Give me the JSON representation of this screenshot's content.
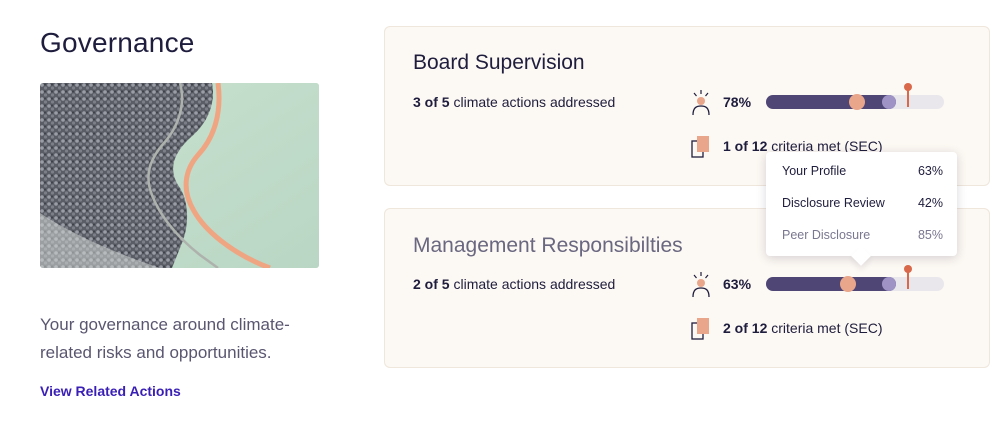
{
  "page": {
    "title": "Governance",
    "description": "Your governance around climate-related risks and opportunities.",
    "related_link": "View Related Actions"
  },
  "colors": {
    "accent": "#3a1fb6",
    "bar_fill": "#4f4676",
    "peer": "#9f93c6",
    "profile": "#e9a68a",
    "marker": "#d9694a",
    "card_bg": "#fcf8f3"
  },
  "cards": [
    {
      "title": "Board Supervision",
      "actions_count": "3 of 5",
      "actions_suffix": "climate actions addressed",
      "percent": "78%",
      "progress": {
        "fill": 0.73,
        "profile": 0.51,
        "peer": 0.69,
        "disclosure": 0.8
      },
      "criteria_count": "1 of 12",
      "criteria_suffix": "criteria met (SEC)",
      "icons": [
        "person-icon",
        "document-icon"
      ]
    },
    {
      "title": "Management Responsibilties",
      "actions_count": "2 of 5",
      "actions_suffix": "climate actions addressed",
      "percent": "63%",
      "progress": {
        "fill": 0.73,
        "profile": 0.46,
        "peer": 0.69,
        "disclosure": 0.8
      },
      "criteria_count": "2 of 12",
      "criteria_suffix": "criteria met (SEC)",
      "icons": [
        "person-icon",
        "document-icon"
      ]
    }
  ],
  "tooltip": {
    "rows": [
      {
        "label": "Your Profile",
        "value": "63%"
      },
      {
        "label": "Disclosure Review",
        "value": "42%"
      },
      {
        "label": "Peer Disclosure",
        "value": "85%"
      }
    ]
  }
}
